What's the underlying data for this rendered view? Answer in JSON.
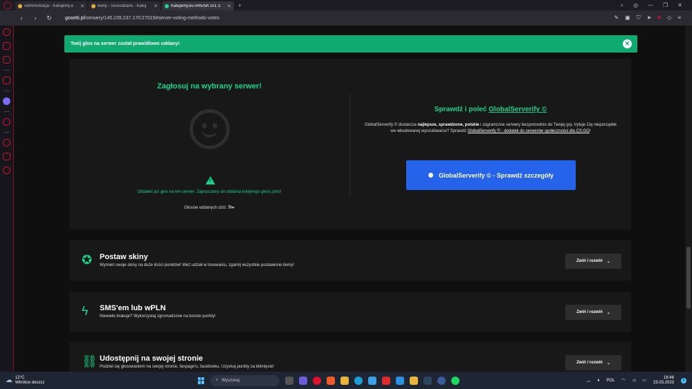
{
  "browser": {
    "tabs": [
      {
        "title": "Administracja - Katujemy.e"
      },
      {
        "title": "Bany - Sourcebans - Katuj"
      },
      {
        "title": "Katujemy.eu ARENA 1v1 1:"
      }
    ],
    "new_tab": "+",
    "url_domain": "gosetti.pl",
    "url_path": "/serwery/145.239.237.170:27015#server-voting-methods-votes"
  },
  "toast": {
    "message": "Twój głos na serwer został prawidłowo oddany!",
    "close": "✕"
  },
  "vote": {
    "title": "Zagłosuj na wybrany serwer!",
    "warning_glyph": "!",
    "info": "Oddałeś już głos na ten serwer. Zapraszamy do oddania kolejnego głosu jutro!",
    "count_label": "Głosów oddanych dziś:",
    "count_value": "7/∞"
  },
  "globalserverify": {
    "title_prefix": "Sprawdź i poleć",
    "title_link": "GlobalServerify ©",
    "desc_1": "GlobalServerify © dostarcza",
    "desc_bold": "najlepsze, sprawdzone, polskie",
    "desc_2": "i zagraniczne serwery bezpośrednio do Twojej gry. Irytuje Cię nieporządek we wbudowanej wyszukiwarce? Sprawdź",
    "desc_link": "GlobalServerify © - dodatek do serwerów społeczności dla CS:GO",
    "desc_end": "!",
    "button": "GlobalServerify © - Sprawdź szczegóły"
  },
  "cards": [
    {
      "title": "Postaw skiny",
      "desc": "Wymień swoje skiny na duże ilości punktów! Weź udział w losowaniu, zgarnij wszystkie postawione itemy!",
      "button": "Zwiń / rozwiń",
      "icon": "award-icon"
    },
    {
      "title": "SMS'em lub wPLN",
      "desc": "Niewiele brakuje? Wykorzystaj zgromadzone na koncie punkty!",
      "button": "Zwiń / rozwiń",
      "icon": "bolt-icon"
    },
    {
      "title": "Udostępnij na swojej stronie",
      "desc": "Podziel się głosowaniem na swojej stronie, fanpage'u, facebooku. Uzyskaj punkty za kliknięcie!",
      "button": "Zwiń / rozwiń",
      "icon": "link-icon"
    }
  ],
  "taskbar": {
    "temp": "12°C",
    "weather": "Wkrótce deszcz",
    "search": "Wyszukaj",
    "lang": "POL",
    "time": "16:46",
    "date": "23.03.2023",
    "notif_count": "5"
  },
  "colors": {
    "accent": "#16d38c",
    "toast": "#0faa72",
    "button_blue": "#2563eb",
    "opera_red": "#e0102f"
  }
}
